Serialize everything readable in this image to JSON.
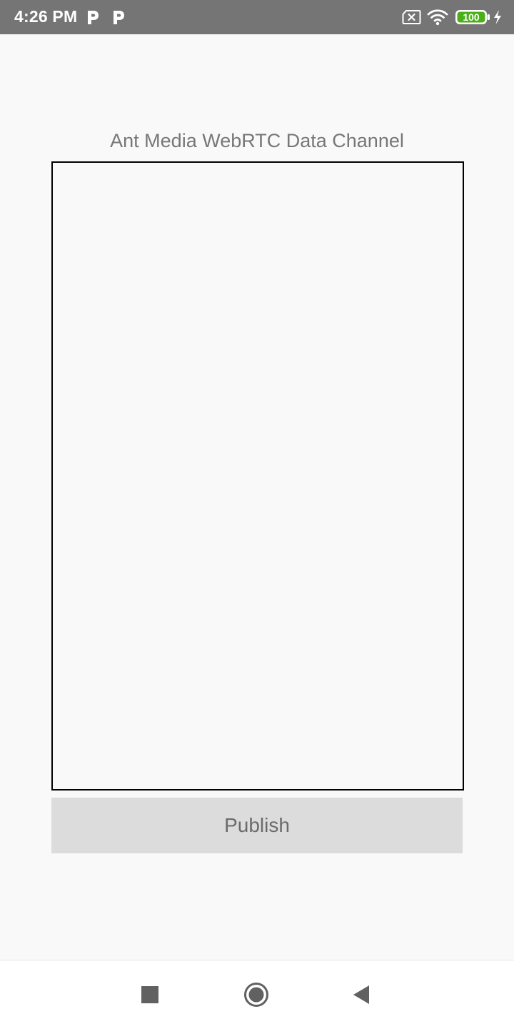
{
  "status_bar": {
    "time": "4:26 PM",
    "app_icons": [
      "parking-p-icon",
      "parking-p-icon"
    ],
    "right_icons": [
      "sim-disabled-icon",
      "wifi-icon",
      "battery-icon",
      "charging-bolt-icon"
    ],
    "battery_level": "100",
    "colors": {
      "background": "#757575",
      "battery_fill": "#4caf1a"
    }
  },
  "main": {
    "title": "Ant Media WebRTC Data Channel",
    "publish_label": "Publish"
  },
  "nav_bar": {
    "buttons": [
      "recents-square-icon",
      "home-circle-icon",
      "back-triangle-icon"
    ]
  }
}
